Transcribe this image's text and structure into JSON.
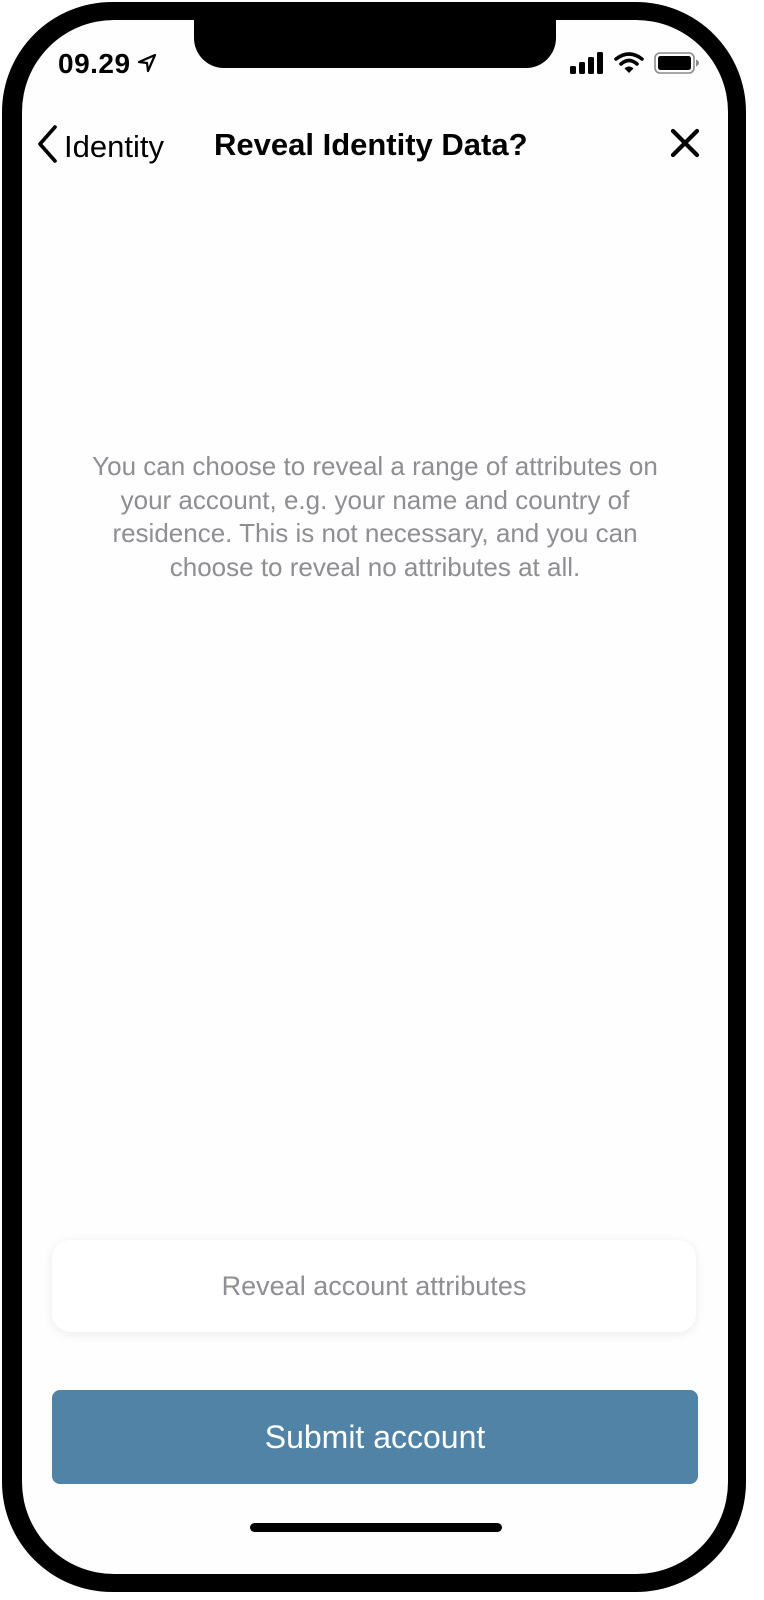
{
  "status_bar": {
    "time": "09.29",
    "location_icon": "location-arrow-icon",
    "signal_icon": "cellular-signal-icon",
    "wifi_icon": "wifi-icon",
    "battery_icon": "battery-icon"
  },
  "nav": {
    "back_label": "Identity",
    "title": "Reveal Identity Data?",
    "back_icon": "chevron-left-icon",
    "close_icon": "close-icon"
  },
  "main": {
    "message": "You can choose to reveal a range of attributes on your account, e.g. your name and country of residence. This is not necessary, and you can choose to reveal no attributes at all."
  },
  "actions": {
    "reveal_label": "Reveal account attributes",
    "submit_label": "Submit account"
  },
  "colors": {
    "accent": "#5183a6",
    "secondary_text": "#8e8e93"
  }
}
